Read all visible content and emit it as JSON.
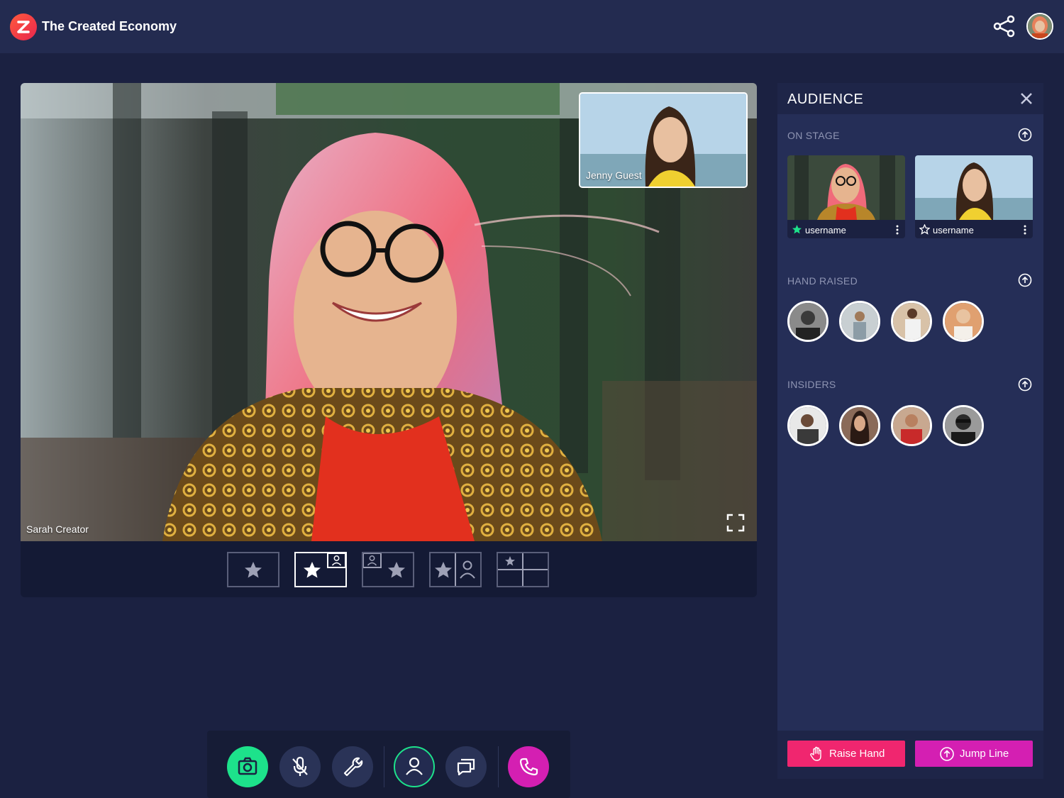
{
  "app": {
    "title": "The Created Economy"
  },
  "header": {
    "share_icon": "share-icon",
    "avatar": "user-avatar"
  },
  "stage": {
    "presenter_name": "Sarah Creator",
    "guest_name": "Jenny Guest",
    "layouts": [
      {
        "name": "single-star",
        "active": false
      },
      {
        "name": "star-with-pip",
        "active": true
      },
      {
        "name": "pip-with-star",
        "active": false
      },
      {
        "name": "split-star-person",
        "active": false
      },
      {
        "name": "grid-four",
        "active": false
      }
    ]
  },
  "controls": [
    {
      "name": "camera-icon",
      "color": "#1de28b"
    },
    {
      "name": "mic-off-icon",
      "color": "#2a3357"
    },
    {
      "name": "wrench-icon",
      "color": "#2a3357"
    },
    {
      "name": "person-icon",
      "color": "#1de28b"
    },
    {
      "name": "chat-icon",
      "color": "#2a3357"
    },
    {
      "name": "phone-icon",
      "color": "#d41fb2"
    }
  ],
  "audience": {
    "title": "AUDIENCE",
    "on_stage": {
      "title": "ON STAGE",
      "cards": [
        {
          "username": "username",
          "starred": true
        },
        {
          "username": "username",
          "starred": false
        }
      ]
    },
    "hand_raised": {
      "title": "HAND RAISED"
    },
    "insiders": {
      "title": "INSIDERS"
    },
    "raise_hand_label": "Raise Hand",
    "jump_line_label": "Jump Line"
  },
  "colors": {
    "accent_green": "#1de28b",
    "accent_pink": "#f0266f",
    "accent_magenta": "#d41fb2",
    "bg": "#1b2141",
    "panel": "#252e57"
  }
}
